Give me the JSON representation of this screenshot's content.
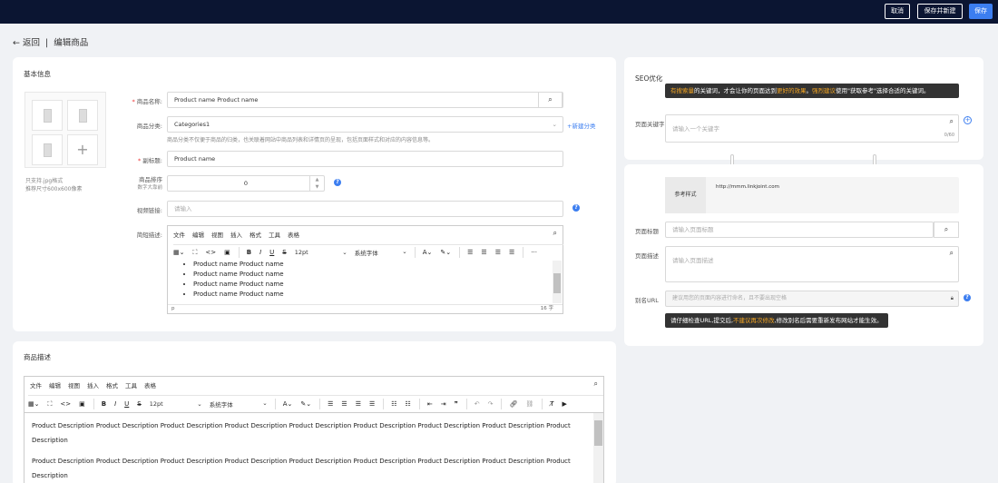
{
  "topbar": {
    "cancel": "取消",
    "save_new": "保存并新建",
    "save": "保存"
  },
  "header": {
    "back": "返回",
    "divider": "|",
    "title": "编辑商品"
  },
  "basic": {
    "title": "基本信息",
    "image_note1": "只支持.jpg格式",
    "image_note2": "推荐尺寸600x600像素",
    "add_symbol": "+",
    "name_label": "商品名称:",
    "name_value": "Product name Product name",
    "category_label": "商品分类:",
    "category_value": "Categories1",
    "new_category": "+新建分类",
    "category_hint": "商品分类不仅便于商品的归类，也关联着网站中商品列表和详情页的呈现，包括页面样式和对应的内容信息等。",
    "subtitle_label": "副标题:",
    "subtitle_value": "Product name",
    "sort_label": "商品排序",
    "sort_sub": "数字大靠前",
    "sort_value": "0",
    "video_label": "视频链接:",
    "video_placeholder": "请输入",
    "brief_label": "简短描述:",
    "menu": [
      "文件",
      "编辑",
      "视图",
      "插入",
      "格式",
      "工具",
      "表格"
    ],
    "font_size": "12pt",
    "font_family": "系统字体",
    "bullets": [
      "Product name Product name",
      "Product name Product name",
      "Product name Product name",
      "Product name Product name"
    ],
    "status_left": "p",
    "status_right": "16 字"
  },
  "desc": {
    "title": "商品描述",
    "menu": [
      "文件",
      "编辑",
      "视图",
      "插入",
      "格式",
      "工具",
      "表格"
    ],
    "font_size": "12pt",
    "font_family": "系统字体",
    "paragraphs": [
      "Product Description Product Description Product Description Product Description Product Description Product Description Product Description Product Description Product Description",
      "Product Description Product Description Product Description Product Description Product Description Product Description Product Description Product Description Product Description"
    ]
  },
  "seo": {
    "title": "SEO优化",
    "tip_parts": [
      "有搜索量",
      "的关键词，才会让你的页面达到",
      "更好的效果",
      "。",
      "强烈建议",
      "使用\"获取参考\"选择合适的关键词。"
    ],
    "keyword_label": "页面关键字",
    "keyword_placeholder": "请输入一个关键字",
    "keyword_count": "0/60",
    "ref_label": "参考样式",
    "ref_url": "http://mmm.linkjoint.com",
    "page_title_label": "页面标题",
    "page_title_placeholder": "请输入页面标题",
    "page_desc_label": "页面描述",
    "page_desc_placeholder": "请输入页面描述",
    "alias_label": "别名URL",
    "alias_placeholder": "建议用您的页面内容进行命名，且不要出现空格",
    "alias_tip_parts": [
      "请仔细检查URL,提交后,",
      "不建议再次修改",
      ",修改别名后需要重新发布网站才能生效。"
    ]
  },
  "colors": {
    "topbar": "#0b1532",
    "primary": "#3c7ef0",
    "tip_highlight": "#f5a623"
  }
}
